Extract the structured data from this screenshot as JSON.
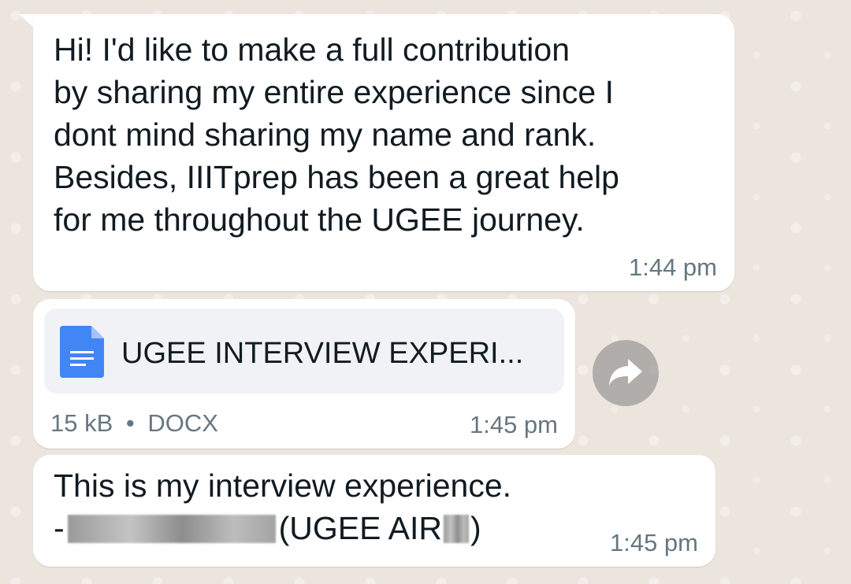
{
  "chat": {
    "messages": [
      {
        "text": "Hi! I'd like to make a full contribution\nby sharing my entire experience since I\ndont mind sharing my name and rank.\nBesides, IIITprep has been a great help\nfor me throughout the UGEE journey.",
        "time": "1:44 pm"
      },
      {
        "document": {
          "name": "UGEE INTERVIEW EXPERI...",
          "size": "15 kB",
          "separator": "•",
          "type": "DOCX",
          "icon": "doc-file-icon"
        },
        "time": "1:45 pm"
      },
      {
        "line1": "This is my interview experience.",
        "line2_prefix": "-",
        "line2_middle": "(UGEE AIR",
        "line2_suffix": ")",
        "time": "1:45 pm"
      }
    ],
    "forward_icon": "forward-arrow-icon"
  },
  "colors": {
    "wallpaper": "#ece5dd",
    "bubble": "#ffffff",
    "doc_icon": "#4285f4",
    "timestamp": "#667781"
  }
}
